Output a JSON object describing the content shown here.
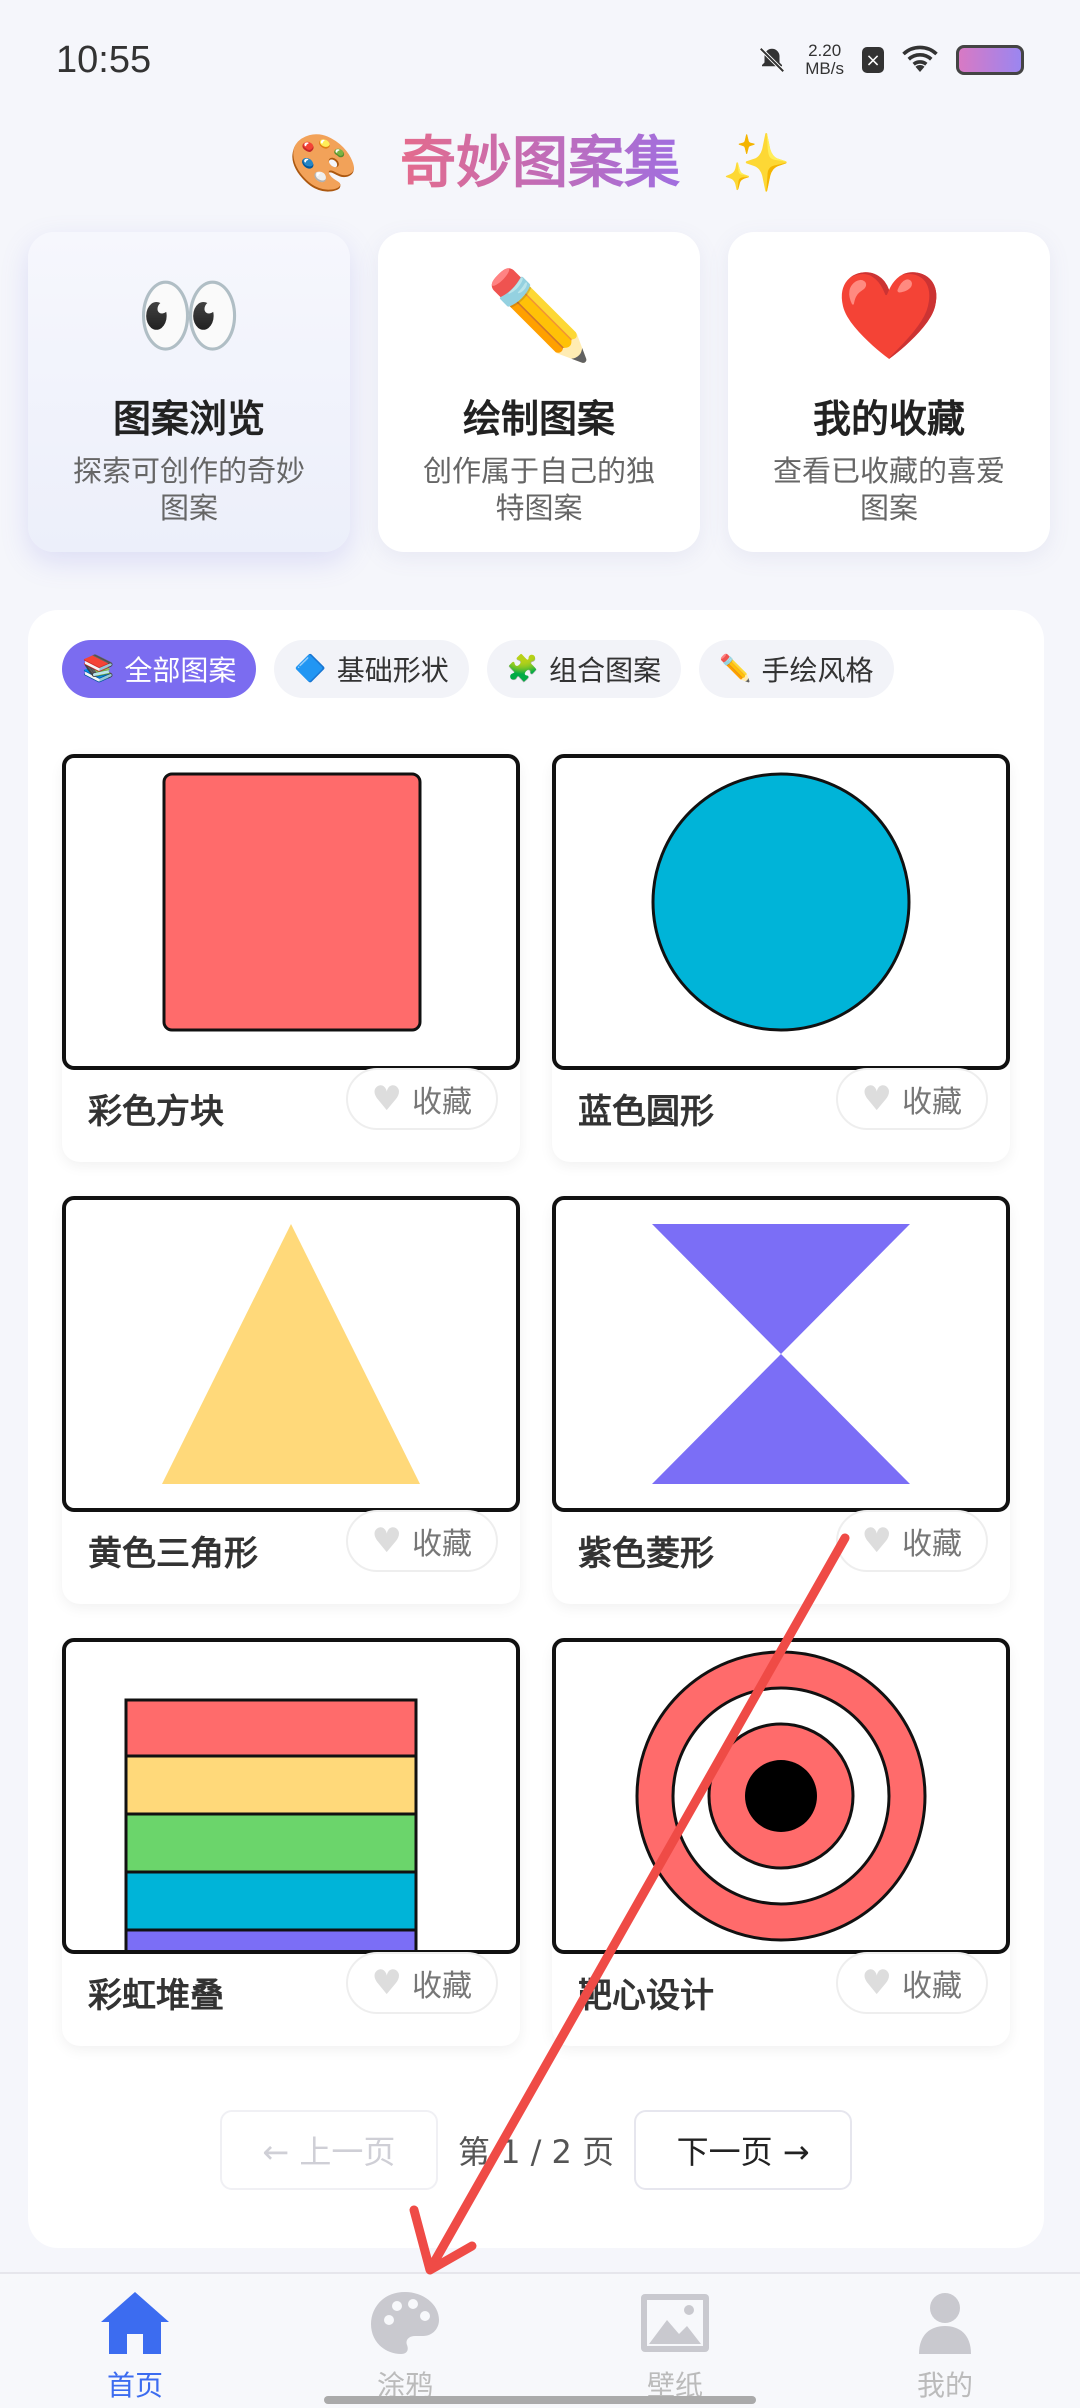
{
  "status_bar": {
    "time": "10:55",
    "speed_value": "2.20",
    "speed_unit": "MB/s"
  },
  "header": {
    "title": "奇妙图案集",
    "left_emoji": "🎨",
    "right_emoji": "✨"
  },
  "features": [
    {
      "icon": "👀",
      "title": "图案浏览",
      "desc": "探索可创作的奇妙图案"
    },
    {
      "icon": "✏️",
      "title": "绘制图案",
      "desc": "创作属于自己的独特图案"
    },
    {
      "icon": "❤️",
      "title": "我的收藏",
      "desc": "查看已收藏的喜爱图案"
    }
  ],
  "filters": [
    {
      "icon": "📚",
      "label": "全部图案",
      "active": true
    },
    {
      "icon": "🔷",
      "label": "基础形状",
      "active": false
    },
    {
      "icon": "🧩",
      "label": "组合图案",
      "active": false
    },
    {
      "icon": "✏️",
      "label": "手绘风格",
      "active": false
    }
  ],
  "patterns": [
    {
      "name": "彩色方块",
      "fav_label": "收藏",
      "shape": "square",
      "color": "#ff6b6b"
    },
    {
      "name": "蓝色圆形",
      "fav_label": "收藏",
      "shape": "circle",
      "color": "#00b4d8"
    },
    {
      "name": "黄色三角形",
      "fav_label": "收藏",
      "shape": "triangle",
      "color": "#ffd97a"
    },
    {
      "name": "紫色菱形",
      "fav_label": "收藏",
      "shape": "hourglass",
      "color": "#7b6ef6"
    },
    {
      "name": "彩虹堆叠",
      "fav_label": "收藏",
      "shape": "rainbow",
      "colors": [
        "#ff6b6b",
        "#ffd97a",
        "#6bd56b",
        "#00b4d8",
        "#7b6ef6"
      ]
    },
    {
      "name": "靶心设计",
      "fav_label": "收藏",
      "shape": "target",
      "color": "#ff6b6b"
    }
  ],
  "pager": {
    "prev": "← 上一页",
    "info": "第 1 / 2 页",
    "next": "下一页 →"
  },
  "nav": [
    {
      "label": "首页",
      "icon": "home-icon",
      "active": true
    },
    {
      "label": "涂鸦",
      "icon": "palette-icon",
      "active": false
    },
    {
      "label": "壁纸",
      "icon": "image-icon",
      "active": false
    },
    {
      "label": "我的",
      "icon": "user-icon",
      "active": false
    }
  ],
  "colors": {
    "accent": "#7b6cf0",
    "nav_active": "#3c6cf0",
    "annotation_arrow": "#ef4b46"
  }
}
